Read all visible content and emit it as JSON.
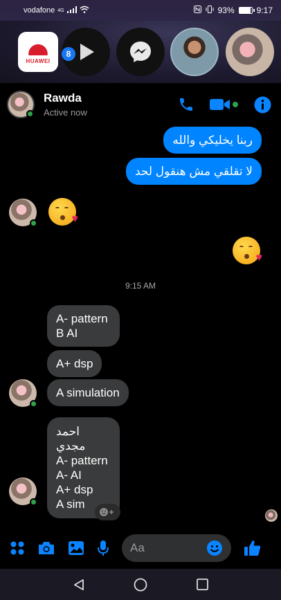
{
  "status_bar": {
    "carrier": "vodafone",
    "network": "4G",
    "battery": "93%",
    "battery_level": 0.93,
    "time": "9:17"
  },
  "chat_heads": {
    "app_tile_label": "HUAWEI",
    "unread_badge": "8"
  },
  "header": {
    "name": "Rawda",
    "status": "Active now"
  },
  "messages": {
    "out1": "ربنا يخليكي والله",
    "out2": "لا تقلقي مش هنقول لحد",
    "timestamp": "9:15 AM",
    "in1": "A- pattern\nB AI",
    "in2": "A+ dsp",
    "in3": "A simulation",
    "in4": "احمد مجدي\nA- pattern\nA- AI\nA+ dsp\nA sim"
  },
  "composer": {
    "placeholder": "Aa"
  },
  "colors": {
    "accent": "#0084ff",
    "incoming_bubble": "#3a3b3c",
    "online": "#31a24c"
  }
}
